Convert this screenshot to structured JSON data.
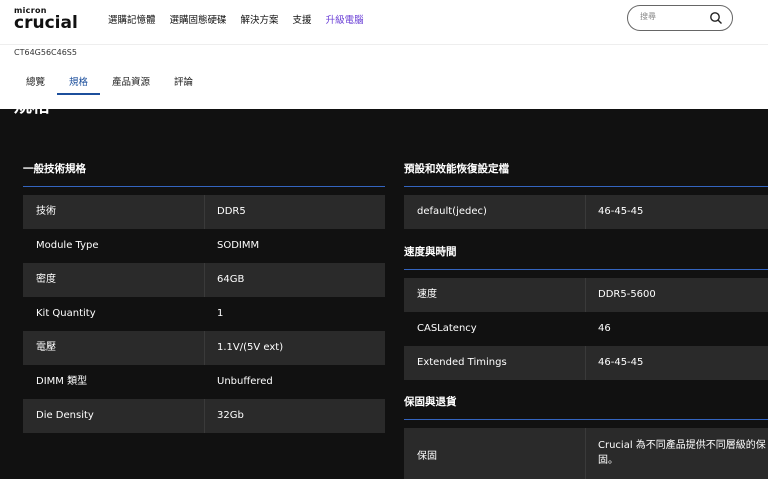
{
  "brand": {
    "small": "micron",
    "name": "crucial"
  },
  "nav": [
    "選購記憶體",
    "選購固態硬碟",
    "解決方案",
    "支援",
    "升級電腦"
  ],
  "search": {
    "placeholder": "搜尋"
  },
  "sku": "CT64G56C46S5",
  "tabs": [
    "總覽",
    "規格",
    "產品資源",
    "評論"
  ],
  "active_tab": "規格",
  "page_heading_partial": "規格",
  "general": {
    "title": "一般技術規格",
    "rows": [
      {
        "k": "技術",
        "v": "DDR5"
      },
      {
        "k": "Module Type",
        "v": "SODIMM"
      },
      {
        "k": "密度",
        "v": "64GB"
      },
      {
        "k": "Kit Quantity",
        "v": "1"
      },
      {
        "k": "電壓",
        "v": "1.1V/(5V ext)"
      },
      {
        "k": "DIMM 類型",
        "v": "Unbuffered"
      },
      {
        "k": "Die Density",
        "v": "32Gb"
      }
    ]
  },
  "profile": {
    "title": "預設和效能恢復設定檔",
    "rows": [
      {
        "k": "default(jedec)",
        "v": "46-45-45"
      }
    ]
  },
  "timing": {
    "title": "速度與時間",
    "rows": [
      {
        "k": "速度",
        "v": "DDR5-5600"
      },
      {
        "k": "CASLatency",
        "v": "46"
      },
      {
        "k": "Extended Timings",
        "v": "46-45-45"
      }
    ]
  },
  "warranty": {
    "title": "保固與退貨",
    "label": "保固",
    "value": "Crucial 為不同產品提供不同層級的保固。"
  },
  "colors": {
    "accent": "#6a3fd6",
    "tab_active": "#1c4f9c",
    "rule": "#3465c0",
    "row_alt": "#2a2a2a",
    "background": "#111111"
  }
}
